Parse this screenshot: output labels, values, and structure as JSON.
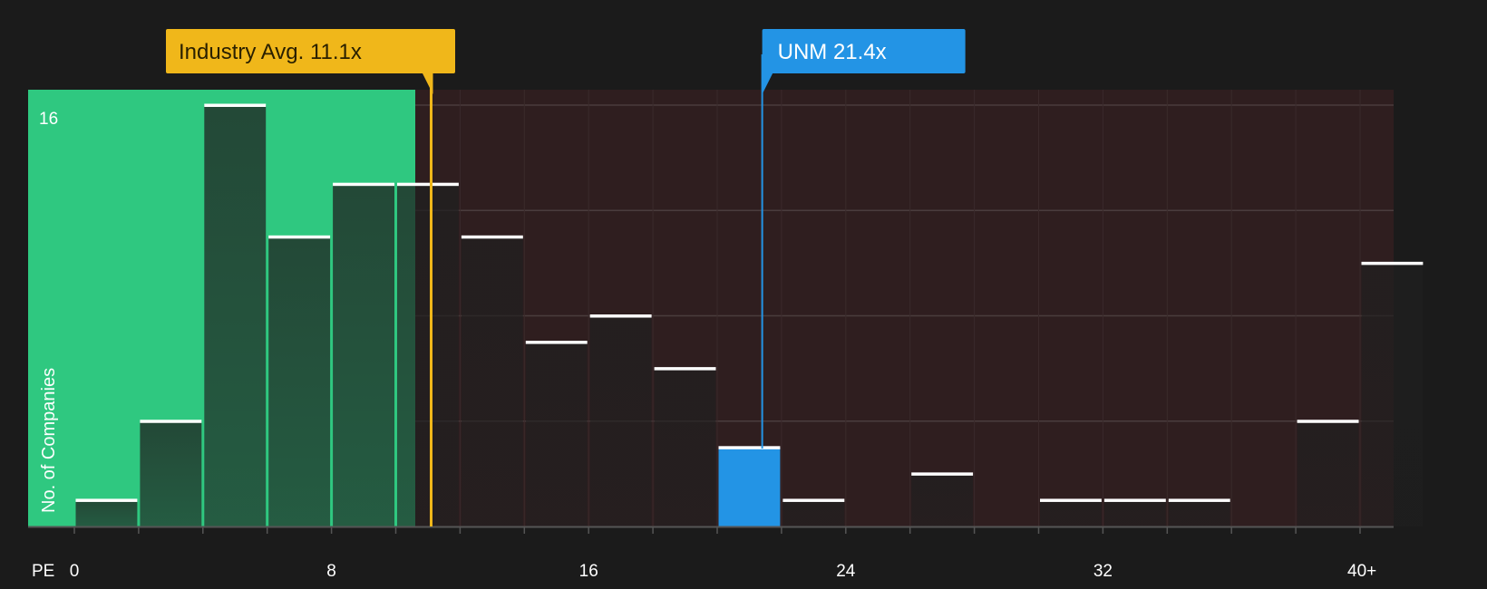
{
  "chart_data": {
    "type": "bar",
    "x_axis_label": "PE",
    "y_axis_label": "No. of Companies",
    "x_ticks": [
      {
        "value": 0,
        "label": "0"
      },
      {
        "value": 8,
        "label": "8"
      },
      {
        "value": 16,
        "label": "16"
      },
      {
        "value": 24,
        "label": "24"
      },
      {
        "value": 32,
        "label": "32"
      },
      {
        "value": 40,
        "label": "40+"
      }
    ],
    "y_ticks": [
      {
        "value": 16,
        "label": "16"
      }
    ],
    "ylim": [
      0,
      16
    ],
    "bin_width": 2,
    "bins": [
      {
        "start": 0,
        "count": 1,
        "zone": "below"
      },
      {
        "start": 2,
        "count": 4,
        "zone": "below"
      },
      {
        "start": 4,
        "count": 16,
        "zone": "below"
      },
      {
        "start": 6,
        "count": 11,
        "zone": "below"
      },
      {
        "start": 8,
        "count": 13,
        "zone": "below"
      },
      {
        "start": 10,
        "count": 13,
        "zone": "below"
      },
      {
        "start": 12,
        "count": 11,
        "zone": "above"
      },
      {
        "start": 14,
        "count": 7,
        "zone": "above"
      },
      {
        "start": 16,
        "count": 8,
        "zone": "above"
      },
      {
        "start": 18,
        "count": 6,
        "zone": "above"
      },
      {
        "start": 20,
        "count": 3,
        "zone": "company"
      },
      {
        "start": 22,
        "count": 1,
        "zone": "above"
      },
      {
        "start": 24,
        "count": 0,
        "zone": "above"
      },
      {
        "start": 26,
        "count": 2,
        "zone": "above"
      },
      {
        "start": 28,
        "count": 0,
        "zone": "above"
      },
      {
        "start": 30,
        "count": 1,
        "zone": "above"
      },
      {
        "start": 32,
        "count": 1,
        "zone": "above"
      },
      {
        "start": 34,
        "count": 1,
        "zone": "above"
      },
      {
        "start": 36,
        "count": 0,
        "zone": "above"
      },
      {
        "start": 38,
        "count": 4,
        "zone": "above"
      },
      {
        "start": 40,
        "count": 10,
        "zone": "above"
      }
    ],
    "industry_avg": {
      "value": 11.1,
      "label": "Industry Avg. 11.1x",
      "color": "#f0b71a"
    },
    "company": {
      "value": 21.4,
      "label": "UNM 21.4x",
      "color": "#2394e5"
    },
    "colors": {
      "background": "#1b1b1b",
      "below_zone": "#2fc880",
      "above_zone": "#2f1e1f",
      "bar_dark": "#222222",
      "bar_top": "#ffffff",
      "grid": "#4a3c3d",
      "axis": "#555555"
    }
  }
}
